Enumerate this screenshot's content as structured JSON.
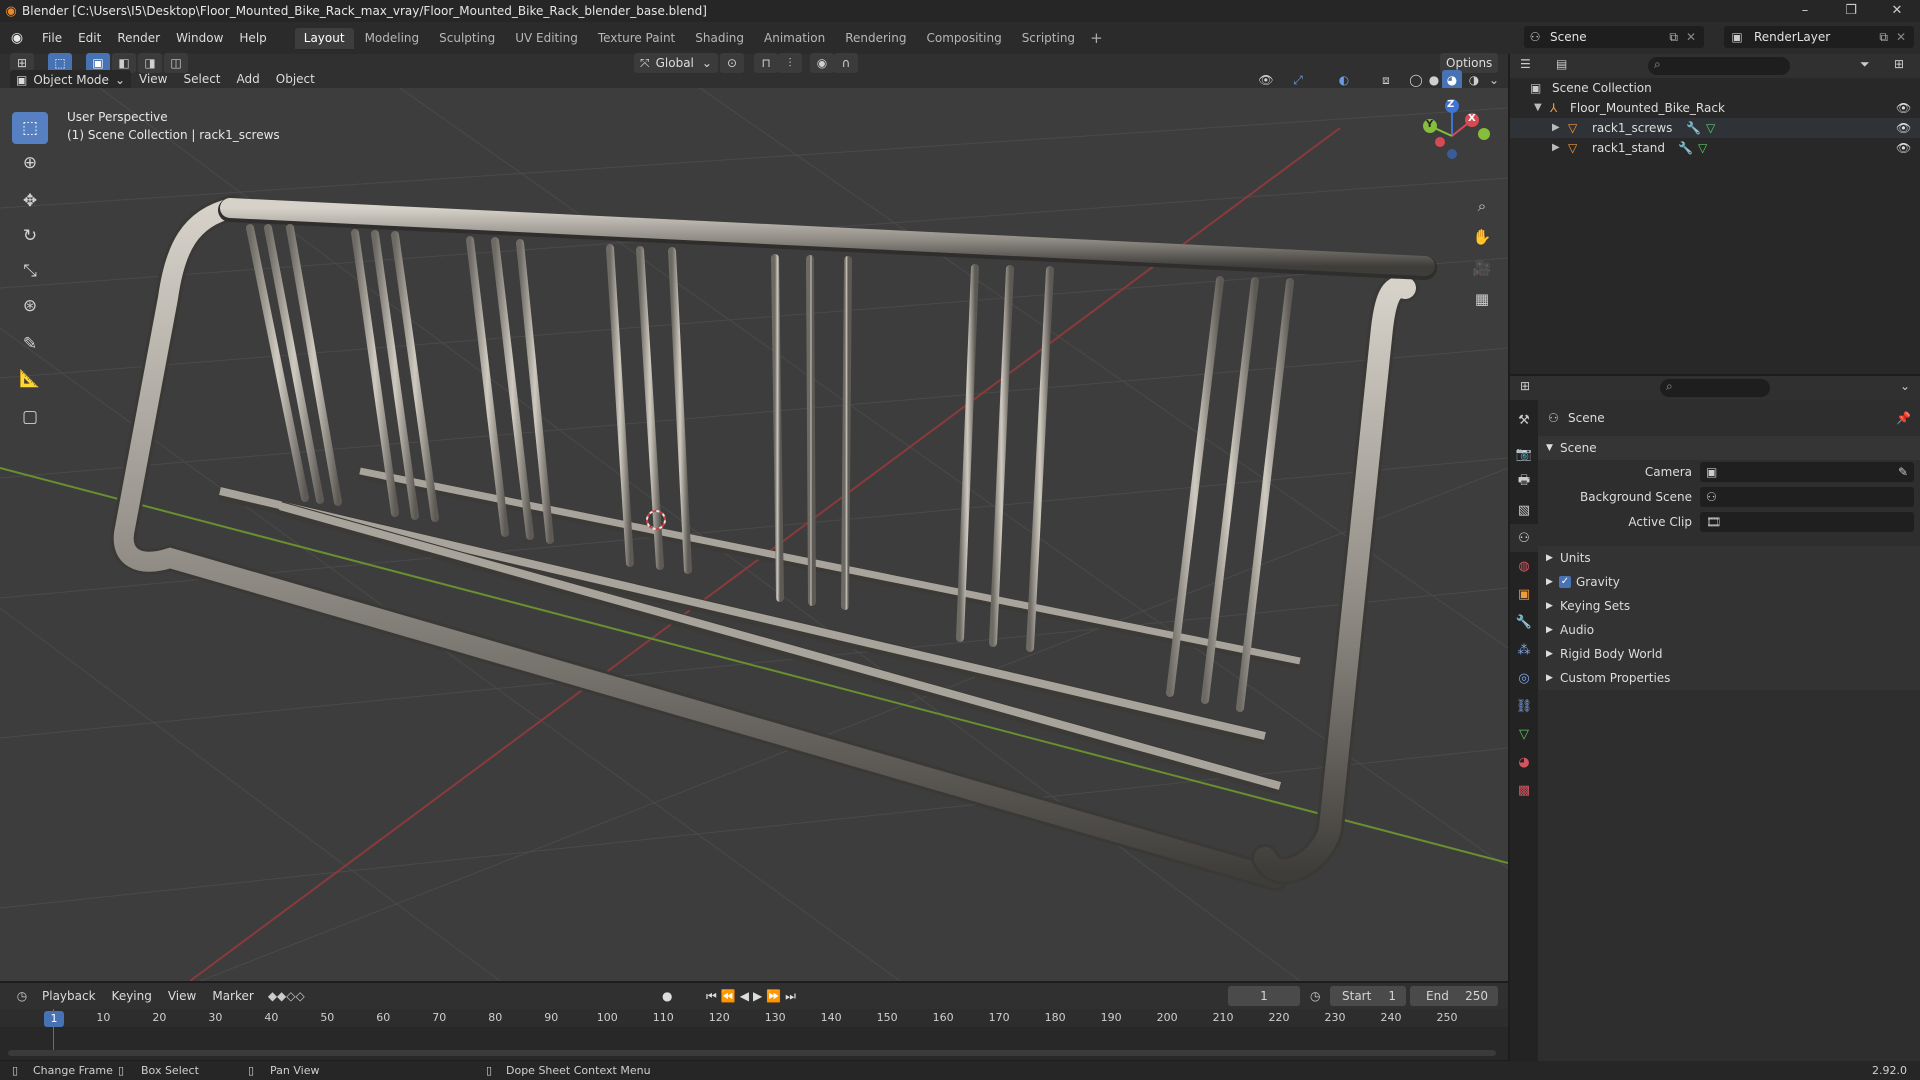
{
  "titlebar": {
    "title": "Blender [C:\\Users\\I5\\Desktop\\Floor_Mounted_Bike_Rack_max_vray/Floor_Mounted_Bike_Rack_blender_base.blend]"
  },
  "menu": [
    "File",
    "Edit",
    "Render",
    "Window",
    "Help"
  ],
  "workspaces": [
    "Layout",
    "Modeling",
    "Sculpting",
    "UV Editing",
    "Texture Paint",
    "Shading",
    "Animation",
    "Rendering",
    "Compositing",
    "Scripting"
  ],
  "scene_selector": "Scene",
  "renderlayer_selector": "RenderLayer",
  "viewport_header": {
    "mode": "Object Mode",
    "menus": [
      "View",
      "Select",
      "Add",
      "Object"
    ],
    "transform": "Global",
    "options": "Options"
  },
  "viewport": {
    "perspective": "User Perspective",
    "collection_info": "(1) Scene Collection | rack1_screws"
  },
  "gizmo": {
    "x": "X",
    "y": "Y",
    "z": "Z"
  },
  "outliner": {
    "root": "Scene Collection",
    "items": [
      {
        "name": "Floor_Mounted_Bike_Rack"
      },
      {
        "name": "rack1_screws"
      },
      {
        "name": "rack1_stand"
      }
    ]
  },
  "properties": {
    "context": "Scene",
    "panel": "Scene",
    "camera_label": "Camera",
    "background_label": "Background Scene",
    "clip_label": "Active Clip",
    "sections": [
      "Units",
      "Gravity",
      "Keying Sets",
      "Audio",
      "Rigid Body World",
      "Custom Properties"
    ]
  },
  "timeline": {
    "menus": [
      "Playback",
      "Keying",
      "View",
      "Marker"
    ],
    "current_frame": "1",
    "start_label": "Start",
    "start": "1",
    "end_label": "End",
    "end": "250",
    "ticks": [
      "1",
      "10",
      "20",
      "30",
      "40",
      "50",
      "60",
      "70",
      "80",
      "90",
      "100",
      "110",
      "120",
      "130",
      "140",
      "150",
      "160",
      "170",
      "180",
      "190",
      "200",
      "210",
      "220",
      "230",
      "240",
      "250"
    ]
  },
  "statusbar": {
    "change_frame": "Change Frame",
    "box_select": "Box Select",
    "pan_view": "Pan View",
    "context_menu": "Dope Sheet Context Menu",
    "version": "2.92.0"
  },
  "colors": {
    "accent": "#4772b3",
    "x_axis": "#d54a54",
    "y_axis": "#86bd3a",
    "z_axis": "#3f74d4",
    "object_orange": "#f09a3e",
    "mesh_green": "#5ec76a"
  }
}
